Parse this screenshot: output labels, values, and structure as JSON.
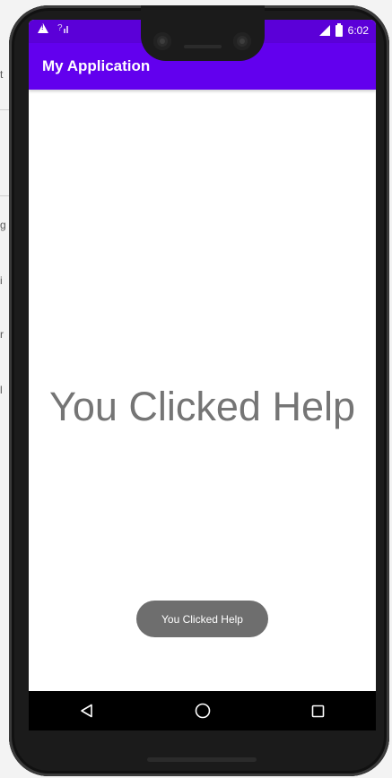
{
  "background": {
    "fragments": [
      "t",
      "g",
      "i",
      "r",
      "l"
    ]
  },
  "status_bar": {
    "signal_label": "?",
    "time": "6:02",
    "icons": [
      "alert-icon",
      "signal-icon",
      "battery-icon"
    ]
  },
  "app_bar": {
    "title": "My Application"
  },
  "main": {
    "message": "You Clicked Help"
  },
  "toast": {
    "text": "You Clicked Help"
  },
  "nav_bar": {
    "icons": [
      "back-icon",
      "home-icon",
      "recents-icon"
    ]
  },
  "colors": {
    "primary": "#6200ee",
    "status_bar": "#5b00d8",
    "message_text": "#757575",
    "toast_bg": "#6e6e6e"
  }
}
